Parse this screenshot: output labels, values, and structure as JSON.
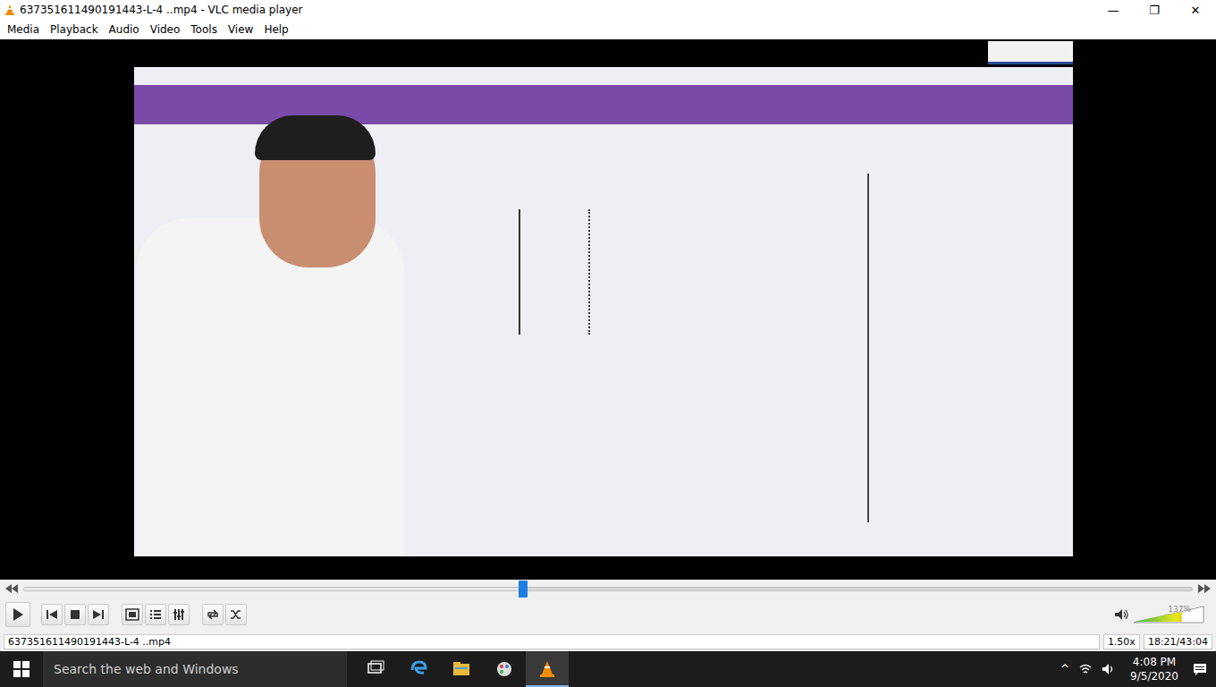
{
  "window": {
    "title": "637351611490191443-L-4 ..mp4 - VLC media player",
    "controls": [
      "—",
      "❐",
      "✕"
    ]
  },
  "menu": [
    "Media",
    "Playback",
    "Audio",
    "Video",
    "Tools",
    "View",
    "Help"
  ],
  "seek": {
    "level": 0.427
  },
  "volume": {
    "level": 0.69,
    "reading": "137%"
  },
  "status_bar": {
    "file": "637351611490191443-L-4 ..mp4",
    "speed": "1.50x",
    "time": "18:21/43:04"
  },
  "taskbar": {
    "search": {
      "placeholder": "Search the web and Windows"
    },
    "apps": [
      {
        "kind": "taskview",
        "active": false
      },
      {
        "kind": "edge",
        "active": false
      },
      {
        "kind": "explorer",
        "active": false
      },
      {
        "kind": "paint",
        "active": false
      },
      {
        "kind": "vlc",
        "active": true
      }
    ],
    "tray": {
      "chevron": "^"
    },
    "clock": {
      "time": "4:08 PM",
      "date": "9/5/2020"
    }
  }
}
